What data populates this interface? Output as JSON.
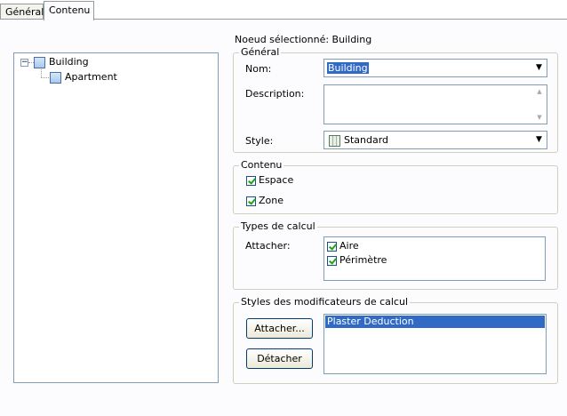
{
  "tabs": [
    {
      "label": "Général",
      "active": false
    },
    {
      "label": "Contenu",
      "active": true
    }
  ],
  "tree": {
    "root": {
      "label": "Building",
      "expanded": true,
      "expander": "−"
    },
    "children": [
      {
        "label": "Apartment"
      }
    ]
  },
  "selected_node_text": "Noeud sélectionné: Building",
  "general": {
    "legend": "Général",
    "name_label": "Nom:",
    "name_value": "Building",
    "description_label": "Description:",
    "description_value": "",
    "style_label": "Style:",
    "style_value": "Standard"
  },
  "content": {
    "legend": "Contenu",
    "items": [
      {
        "label": "Espace",
        "checked": true
      },
      {
        "label": "Zone",
        "checked": true
      }
    ]
  },
  "calc_types": {
    "legend": "Types de calcul",
    "attach_label": "Attacher:",
    "items": [
      {
        "label": "Aire",
        "checked": true
      },
      {
        "label": "Périmètre",
        "checked": true
      }
    ]
  },
  "modifiers": {
    "legend": "Styles des modificateurs de calcul",
    "attach_button": "Attacher...",
    "detach_button": "Détacher",
    "list": [
      "Plaster Deduction"
    ]
  },
  "icons": {
    "dropdown": "chevron-down-icon",
    "scroll_up": "scroll-up-icon",
    "scroll_down": "scroll-down-icon"
  }
}
